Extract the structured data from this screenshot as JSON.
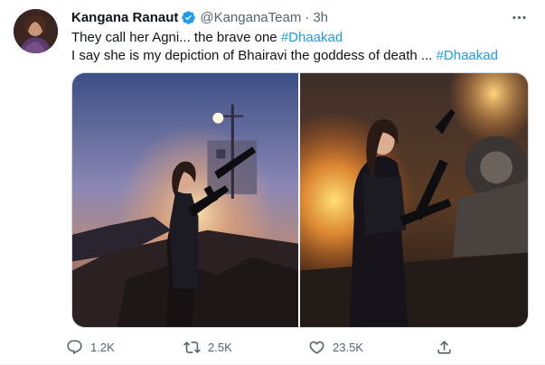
{
  "tweet": {
    "author_name": "Kangana Ranaut",
    "author_handle": "@KanganaTeam",
    "separator": "·",
    "time": "3h",
    "verified": true,
    "line1_text": "They call her Agni... the brave one ",
    "line1_hashtag": "#Dhaakad",
    "line2_text": "I say she is my depiction of Bhairavi the goddess of death ... ",
    "line2_hashtag": "#Dhaakad"
  },
  "media": {
    "count": 2,
    "left_photo_icon": "movie-still-woman-with-rifle-night-scene",
    "right_photo_icon": "movie-still-woman-with-rifle-fire-scene"
  },
  "actions": {
    "reply_count": "1.2K",
    "retweet_count": "2.5K",
    "like_count": "23.5K",
    "reply_icon": "reply-icon",
    "retweet_icon": "retweet-icon",
    "like_icon": "heart-icon",
    "share_icon": "share-icon"
  },
  "colors": {
    "accent": "#1d9bf0",
    "text_primary": "#0f1419",
    "text_secondary": "#536471",
    "border": "#cfd9de"
  }
}
